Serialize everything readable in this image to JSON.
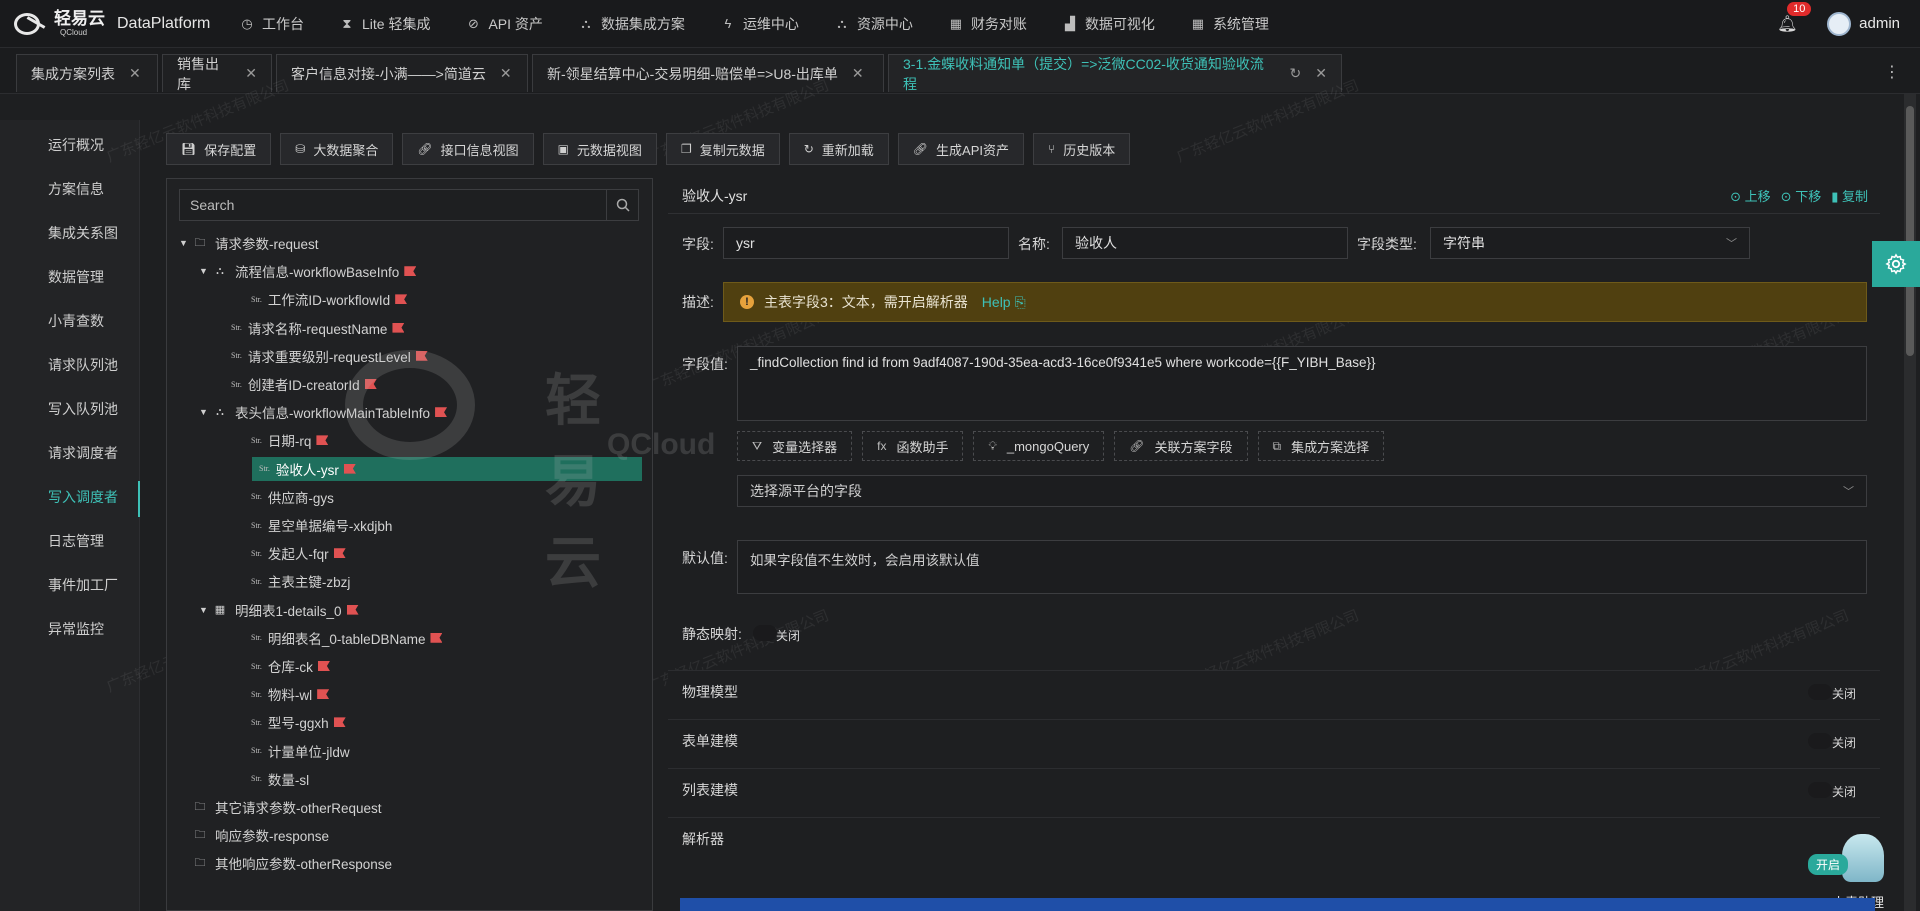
{
  "header": {
    "logo_cn": "轻易云",
    "logo_en": "QCloud",
    "app_name": "DataPlatform",
    "nav": [
      {
        "label": "工作台",
        "icon": "clock-icon"
      },
      {
        "label": "Lite 轻集成",
        "icon": "hourglass-icon"
      },
      {
        "label": "API 资产",
        "icon": "compass-icon"
      },
      {
        "label": "数据集成方案",
        "icon": "nodes-icon"
      },
      {
        "label": "运维中心",
        "icon": "bolt-icon"
      },
      {
        "label": "资源中心",
        "icon": "nodes-icon"
      },
      {
        "label": "财务对账",
        "icon": "grid-icon"
      },
      {
        "label": "数据可视化",
        "icon": "chart-icon"
      },
      {
        "label": "系统管理",
        "icon": "grid-icon"
      }
    ],
    "notification_count": "10",
    "user": "admin"
  },
  "tabs": [
    {
      "label": "集成方案列表"
    },
    {
      "label": "销售出库"
    },
    {
      "label": "客户信息对接-小满——>简道云"
    },
    {
      "label": "新-领星结算中心-交易明细-赔偿单=>U8-出库单"
    },
    {
      "label": "3-1.金蝶收料通知单（提交）=>泛微CC02-收货通知验收流程",
      "active": true
    }
  ],
  "sidebar": {
    "items": [
      {
        "label": "运行概况"
      },
      {
        "label": "方案信息"
      },
      {
        "label": "集成关系图"
      },
      {
        "label": "数据管理"
      },
      {
        "label": "小青查数"
      },
      {
        "label": "请求队列池"
      },
      {
        "label": "写入队列池"
      },
      {
        "label": "请求调度者"
      },
      {
        "label": "写入调度者",
        "active": true
      },
      {
        "label": "日志管理"
      },
      {
        "label": "事件加工厂"
      },
      {
        "label": "异常监控"
      }
    ]
  },
  "toolbar": {
    "buttons": [
      {
        "label": "保存配置",
        "icon": "save-icon"
      },
      {
        "label": "大数据聚合",
        "icon": "database-icon"
      },
      {
        "label": "接口信息视图",
        "icon": "link-icon"
      },
      {
        "label": "元数据视图",
        "icon": "terminal-icon"
      },
      {
        "label": "复制元数据",
        "icon": "copy-icon"
      },
      {
        "label": "重新加载",
        "icon": "reload-icon"
      },
      {
        "label": "生成API资产",
        "icon": "link-icon"
      },
      {
        "label": "历史版本",
        "icon": "branch-icon"
      }
    ]
  },
  "tree": {
    "search_placeholder": "Search",
    "nodes": [
      {
        "label": "请求参数-request",
        "level": 0,
        "type": "folder",
        "expand": true
      },
      {
        "label": "流程信息-workflowBaseInfo",
        "level": 1,
        "type": "object",
        "expand": true,
        "flag": true
      },
      {
        "label": "工作流ID-workflowId",
        "level": 2,
        "type": "str",
        "flag": true
      },
      {
        "label": "请求名称-requestName",
        "level": 1,
        "type": "str",
        "flag": true
      },
      {
        "label": "请求重要级别-requestLevel",
        "level": 1,
        "type": "str",
        "flag": true
      },
      {
        "label": "创建者ID-creatorId",
        "level": 1,
        "type": "str",
        "flag": true
      },
      {
        "label": "表头信息-workflowMainTableInfo",
        "level": 1,
        "type": "object",
        "expand": true,
        "flag": true
      },
      {
        "label": "日期-rq",
        "level": 2,
        "type": "str",
        "flag": true
      },
      {
        "label": "验收人-ysr",
        "level": 2,
        "type": "str",
        "flag": true,
        "selected": true
      },
      {
        "label": "供应商-gys",
        "level": 2,
        "type": "str"
      },
      {
        "label": "星空单据编号-xkdjbh",
        "level": 2,
        "type": "str"
      },
      {
        "label": "发起人-fqr",
        "level": 2,
        "type": "str",
        "flag": true
      },
      {
        "label": "主表主键-zbzj",
        "level": 2,
        "type": "str"
      },
      {
        "label": "明细表1-details_0",
        "level": 1,
        "type": "table",
        "expand": true,
        "flag": true
      },
      {
        "label": "明细表名_0-tableDBName",
        "level": 2,
        "type": "str",
        "flag": true
      },
      {
        "label": "仓库-ck",
        "level": 2,
        "type": "str",
        "flag": true
      },
      {
        "label": "物料-wl",
        "level": 2,
        "type": "str",
        "flag": true
      },
      {
        "label": "型号-ggxh",
        "level": 2,
        "type": "str",
        "flag": true
      },
      {
        "label": "计量单位-jldw",
        "level": 2,
        "type": "str"
      },
      {
        "label": "数量-sl",
        "level": 2,
        "type": "str"
      },
      {
        "label": "其它请求参数-otherRequest",
        "level": 0,
        "type": "folder"
      },
      {
        "label": "响应参数-response",
        "level": 0,
        "type": "folder"
      },
      {
        "label": "其他响应参数-otherResponse",
        "level": 0,
        "type": "folder"
      }
    ]
  },
  "detail": {
    "title": "验收人-ysr",
    "actions": [
      {
        "label": "上移",
        "icon": "up-circle-icon"
      },
      {
        "label": "下移",
        "icon": "down-circle-icon"
      },
      {
        "label": "复制",
        "icon": "copy-icon"
      }
    ],
    "field_label": "字段:",
    "field_value": "ysr",
    "name_label": "名称:",
    "name_value": "验收人",
    "type_label": "字段类型:",
    "type_value": "字符串",
    "desc_label": "描述:",
    "desc_warning": "主表字段3：文本，需开启解析器",
    "desc_help": "Help",
    "value_label": "字段值:",
    "value_text": "_findCollection find id from 9adf4087-190d-35ea-acd3-16ce0f9341e5 where workcode={{F_YIBH_Base}}",
    "value_buttons": [
      {
        "label": "变量选择器",
        "icon": "filter-icon"
      },
      {
        "label": "函数助手",
        "icon": "fx-icon"
      },
      {
        "label": "_mongoQuery",
        "icon": "bulb-icon"
      },
      {
        "label": "关联方案字段",
        "icon": "link-icon"
      },
      {
        "label": "集成方案选择",
        "icon": "nodes-icon"
      }
    ],
    "source_select_placeholder": "选择源平台的字段",
    "default_label": "默认值:",
    "default_placeholder": "如果字段值不生效时，会启用该默认值",
    "static_label": "静态映射:",
    "static_state": "关闭"
  },
  "sections": [
    {
      "label": "物理模型",
      "state": "关闭"
    },
    {
      "label": "表单建模",
      "state": "关闭"
    },
    {
      "label": "列表建模",
      "state": "关闭"
    },
    {
      "label": "解析器",
      "state": "开启"
    }
  ],
  "assistant": {
    "name": "小青助理"
  },
  "watermark_text": "广东轻亿云软件科技有限公司"
}
